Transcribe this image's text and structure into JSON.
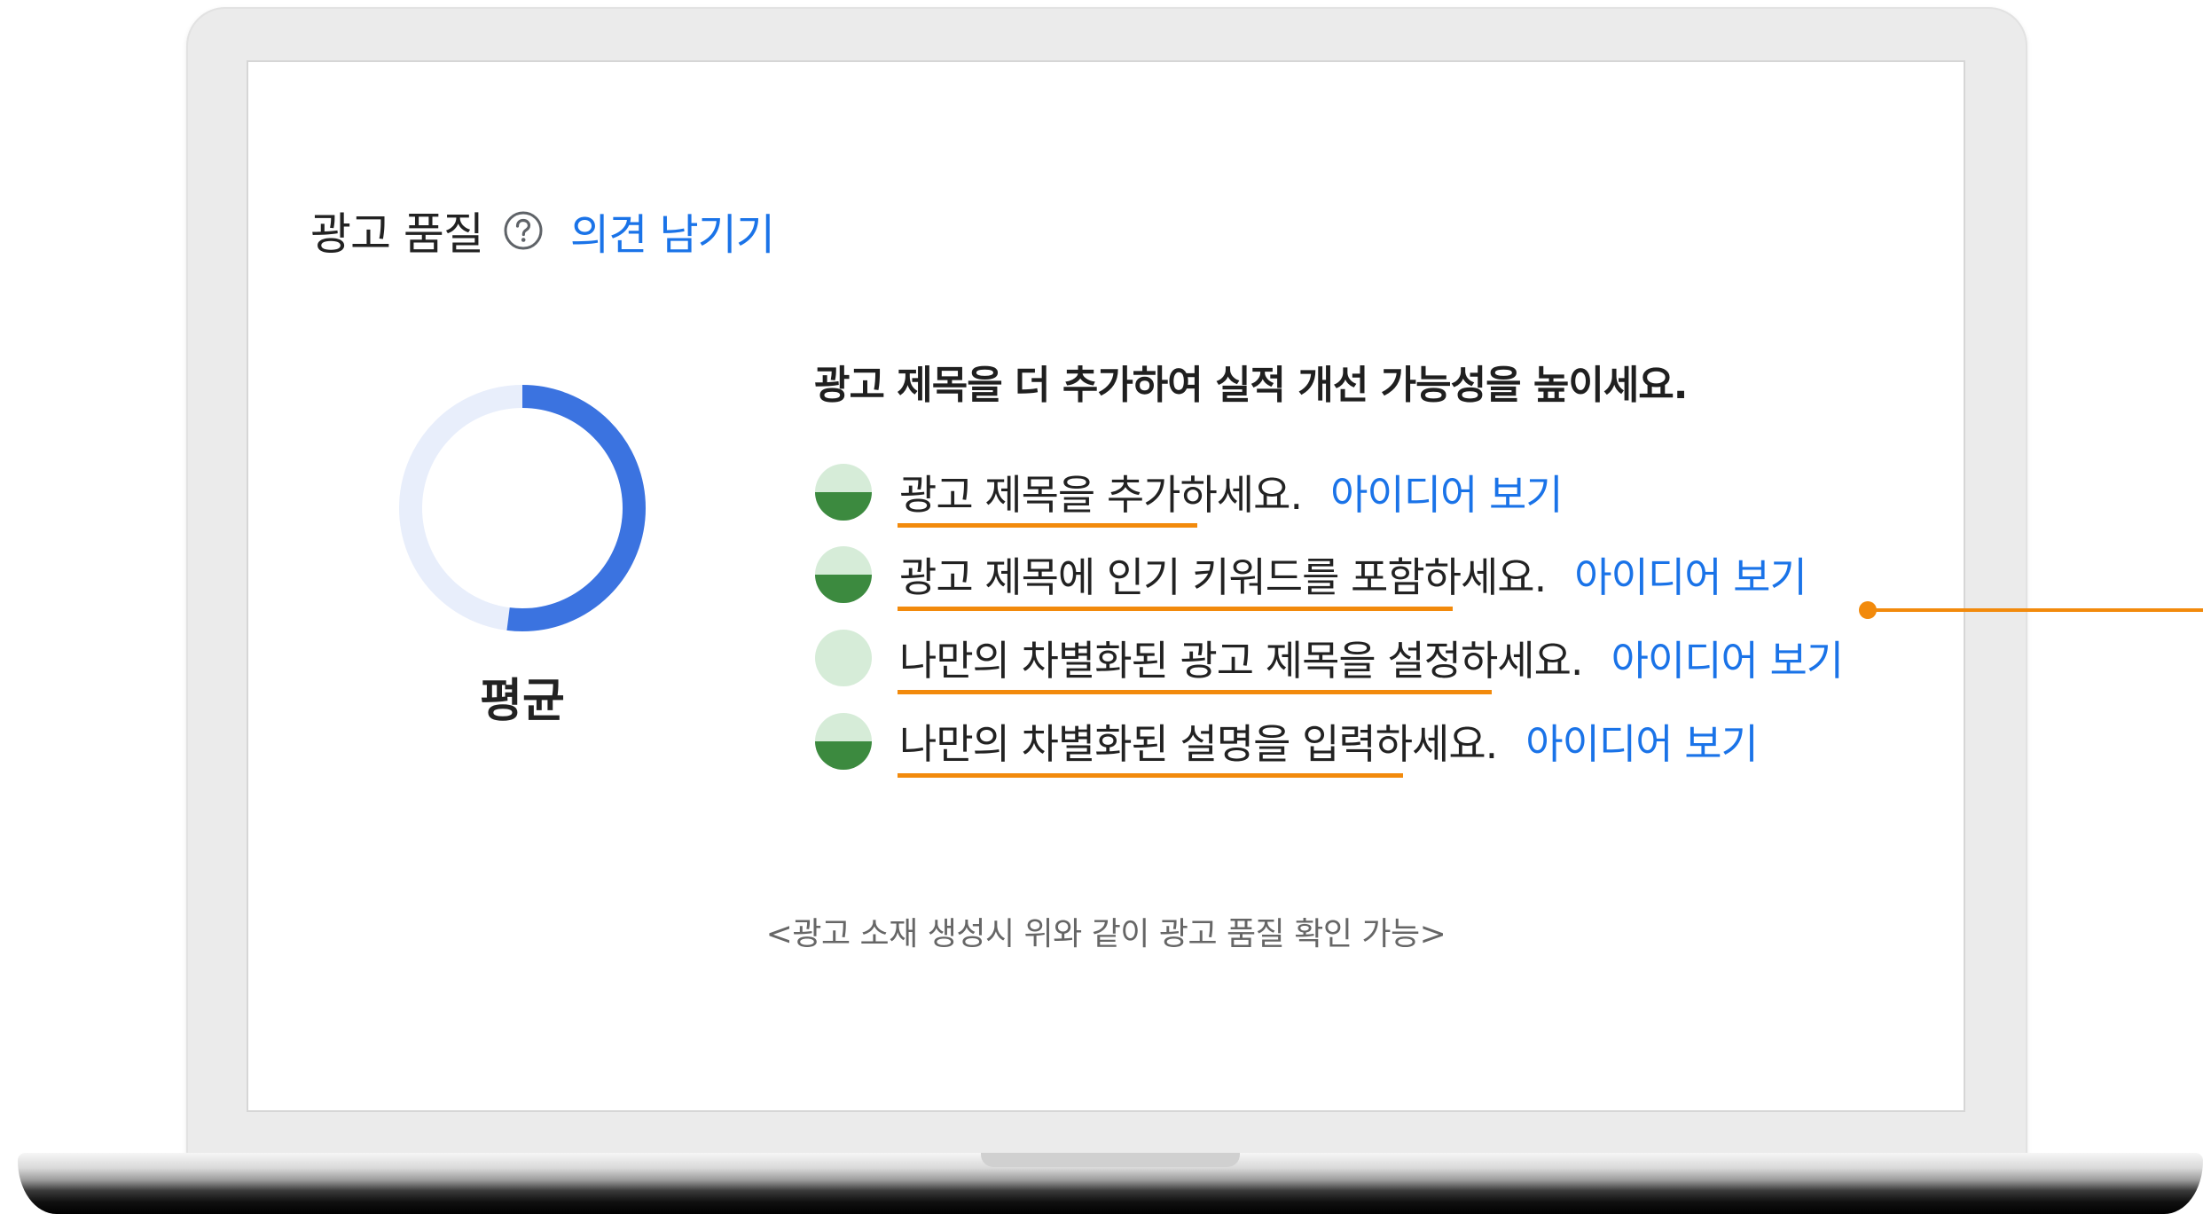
{
  "header": {
    "title": "광고 품질",
    "help_icon": "question-circle-icon",
    "feedback_link": "의견 남기기"
  },
  "score": {
    "label": "평균",
    "fraction": 0.52,
    "colors": {
      "fill": "#3b73e0",
      "track": "#e8eefb"
    }
  },
  "suggestions": {
    "heading": "광고 제목을 더 추가하여 실적 개선 가능성을 높이세요.",
    "items": [
      {
        "text": "광고 제목을 추가하세요.",
        "link": "아이디어 보기",
        "status": "half"
      },
      {
        "text": "광고 제목에 인기 키워드를 포함하세요.",
        "link": "아이디어 보기",
        "status": "half"
      },
      {
        "text": "나만의 차별화된 광고 제목을 설정하세요.",
        "link": "아이디어 보기",
        "status": "empty"
      },
      {
        "text": "나만의 차별화된 설명을 입력하세요.",
        "link": "아이디어 보기",
        "status": "half"
      }
    ],
    "colors": {
      "indicator_fill": "#3c8a3f",
      "indicator_light": "#d6ecd8",
      "highlight": "#f28a0c"
    }
  },
  "caption": "<광고 소재 생성시 위와 같이 광고 품질 확인 가능>"
}
